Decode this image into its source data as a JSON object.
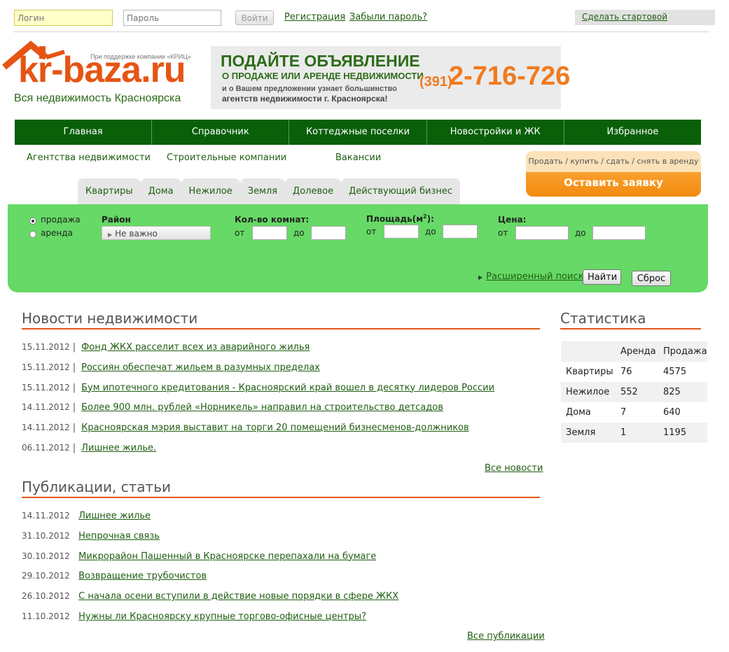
{
  "top": {
    "login_placeholder": "Логин",
    "password_placeholder": "Пароль",
    "enter_label": "Войти",
    "register_label": "Регистрация",
    "forgot_label": "Забыли пароль?",
    "start_page_label": "Сделать стартовой"
  },
  "logo": {
    "support": "При поддержке компании «КРИЦ»",
    "name": "kr-baza.ru",
    "tagline": "Вся недвижимость Красноярска",
    "color": "#e65414"
  },
  "banner": {
    "line1": "ПОДАЙТЕ ОБЪЯВЛЕНИЕ",
    "line2": "О ПРОДАЖЕ ИЛИ АРЕНДЕ НЕДВИЖИМОСТИ",
    "line3": "и о Вашем предложении узнает большинство",
    "line4": "агентств недвижимости г. Красноярска!",
    "code": "(391)",
    "phone": "2-716-726"
  },
  "nav": {
    "main": [
      "Главная",
      "Справочник",
      "Коттеджные поселки",
      "Новостройки и ЖК",
      "Избранное"
    ],
    "sub": [
      "Агентства недвижимости",
      "Строительные компании",
      "Вакансии"
    ]
  },
  "cta": {
    "top": "Продать / купить / сдать / снять в аренду",
    "button": "Оставить заявку"
  },
  "tabs": [
    "Квартиры",
    "Дома",
    "Нежилое",
    "Земля",
    "Долевое",
    "Действующий бизнес"
  ],
  "search": {
    "sale": "продажа",
    "rent": "аренда",
    "district_label": "Район",
    "district_value": "Не важно",
    "rooms_label": "Кол-во комнат:",
    "area_label": "Площадь(м",
    "area_sup": "2",
    "area_end": "):",
    "price_label": "Цена:",
    "from": "от",
    "to": "до",
    "advanced": "Расширенный поиск",
    "find": "Найти",
    "reset": "Сброс"
  },
  "news": {
    "title": "Новости недвижимости",
    "items": [
      {
        "date": "15.11.2012",
        "text": "Фонд ЖКХ расселит всех из аварийного жилья"
      },
      {
        "date": "15.11.2012",
        "text": "Россиян обеспечат жильем в разумных пределах"
      },
      {
        "date": "15.11.2012",
        "text": "Бум ипотечного кредитования - Красноярский край вошел в десятку лидеров России"
      },
      {
        "date": "14.11.2012",
        "text": "Более 900 млн. рублей «Норникель» направил на строительство детсадов"
      },
      {
        "date": "14.11.2012",
        "text": "Красноярская мэрия выставит на торги 20 помещений бизнесменов-должников"
      },
      {
        "date": "06.11.2012",
        "text": "Лишнее жилье."
      }
    ],
    "all": "Все новости"
  },
  "articles": {
    "title": "Публикации, статьи",
    "items": [
      {
        "date": "14.11.2012",
        "text": "Лишнее жилье"
      },
      {
        "date": "31.10.2012",
        "text": "Непрочная связь"
      },
      {
        "date": "30.10.2012",
        "text": "Микрорайон Пашенный в Красноярске перепахали на бумаге"
      },
      {
        "date": "29.10.2012",
        "text": "Возвращение трубочистов"
      },
      {
        "date": "26.10.2012",
        "text": "С начала осени вступили в действие новые порядки в сфере ЖКХ"
      },
      {
        "date": "11.10.2012",
        "text": "Нужны ли Красноярску крупные торгово-офисные центры?"
      }
    ],
    "all": "Все публикации"
  },
  "stats": {
    "title": "Статистика",
    "col_rent": "Аренда",
    "col_sale": "Продажа",
    "rows": [
      {
        "name": "Квартиры",
        "rent": "76",
        "sale": "4575"
      },
      {
        "name": "Нежилое",
        "rent": "552",
        "sale": "825"
      },
      {
        "name": "Дома",
        "rent": "7",
        "sale": "640"
      },
      {
        "name": "Земля",
        "rent": "1",
        "sale": "1195"
      }
    ]
  },
  "colors": {
    "nav_green": "#096009",
    "search_green": "#66d966",
    "accent_orange": "#e0561a",
    "link_green": "#1f5e12"
  }
}
